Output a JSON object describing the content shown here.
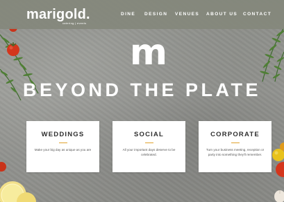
{
  "brand": {
    "logo": "marigold.",
    "tagline": "catering | events"
  },
  "nav": {
    "items": [
      {
        "label": "DINE"
      },
      {
        "label": "DESIGN"
      },
      {
        "label": "VENUES"
      },
      {
        "label": "ABOUT US"
      },
      {
        "label": "CONTACT"
      }
    ]
  },
  "hero": {
    "mark": "m",
    "title": "BEYOND THE PLATE"
  },
  "cards": [
    {
      "title": "WEDDINGS",
      "text": "Make your big day as unique as you are"
    },
    {
      "title": "SOCIAL",
      "text": "All your important days deserve to be celebrated."
    },
    {
      "title": "CORPORATE",
      "text": "Turn your business meeting, reception or party into something they'll remember."
    }
  ],
  "colors": {
    "nav_bg": "#84887c",
    "accent": "#e0a12c",
    "card_bg": "#ffffff"
  },
  "icons": [
    "tomato",
    "rosemary-herb",
    "lemon-slice",
    "yellow-tomato",
    "garlic"
  ]
}
